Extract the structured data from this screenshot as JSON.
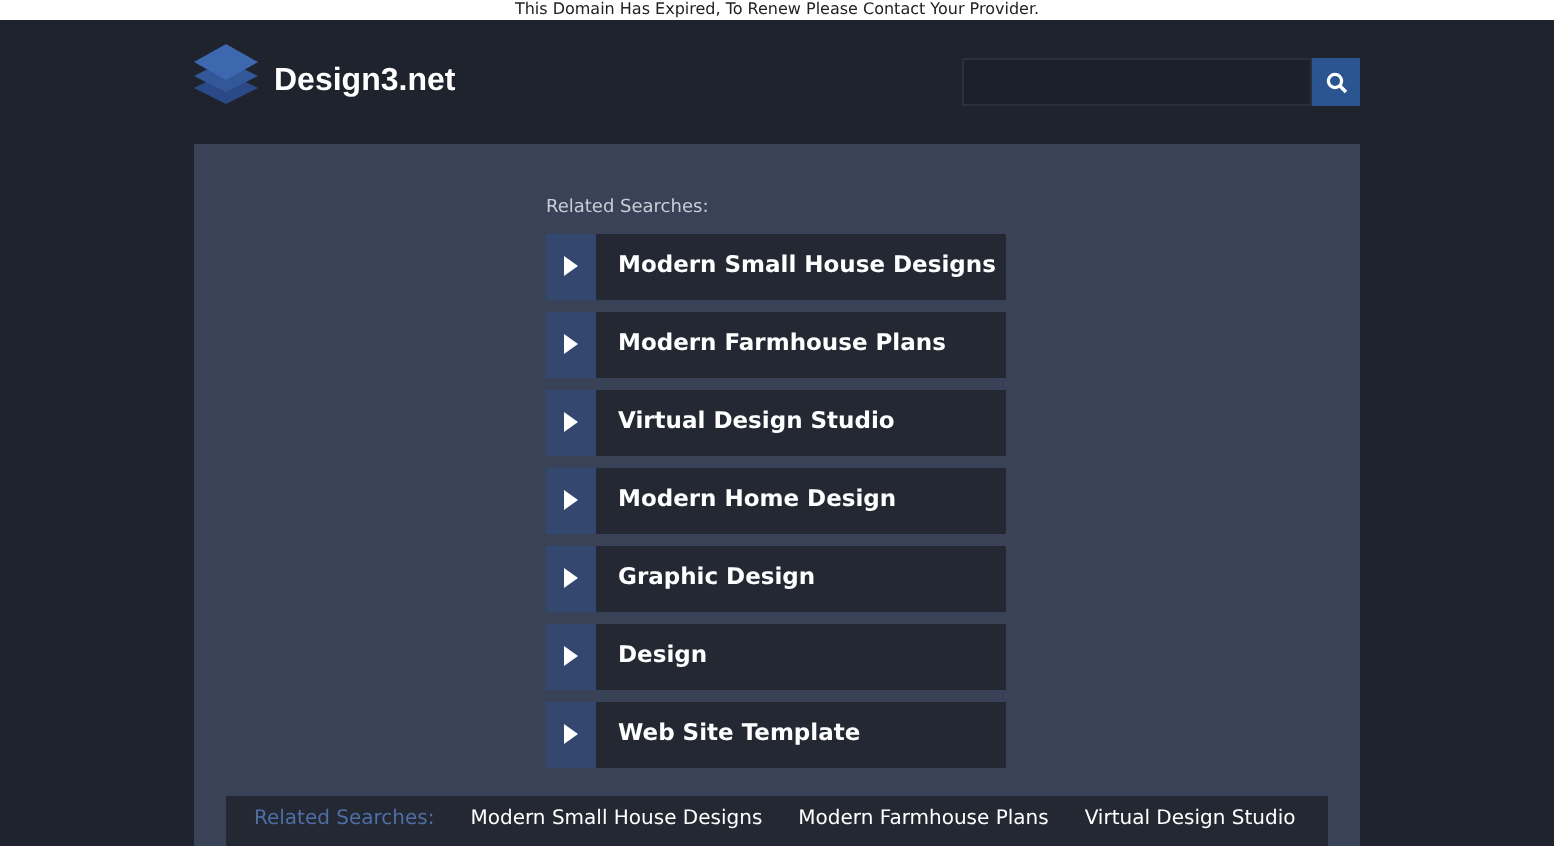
{
  "notice": "This Domain Has Expired, To Renew Please Contact Your Provider.",
  "header": {
    "logo_text": "Design3.net"
  },
  "related_heading": "Related Searches:",
  "links": [
    {
      "label": "Modern Small House Designs"
    },
    {
      "label": "Modern Farmhouse Plans"
    },
    {
      "label": "Virtual Design Studio"
    },
    {
      "label": "Modern Home Design"
    },
    {
      "label": "Graphic Design"
    },
    {
      "label": "Design"
    },
    {
      "label": "Web Site Template"
    }
  ],
  "footer_bar": {
    "heading": "Related Searches:",
    "links": [
      "Modern Small House Designs",
      "Modern Farmhouse Plans",
      "Virtual Design Studio"
    ]
  }
}
